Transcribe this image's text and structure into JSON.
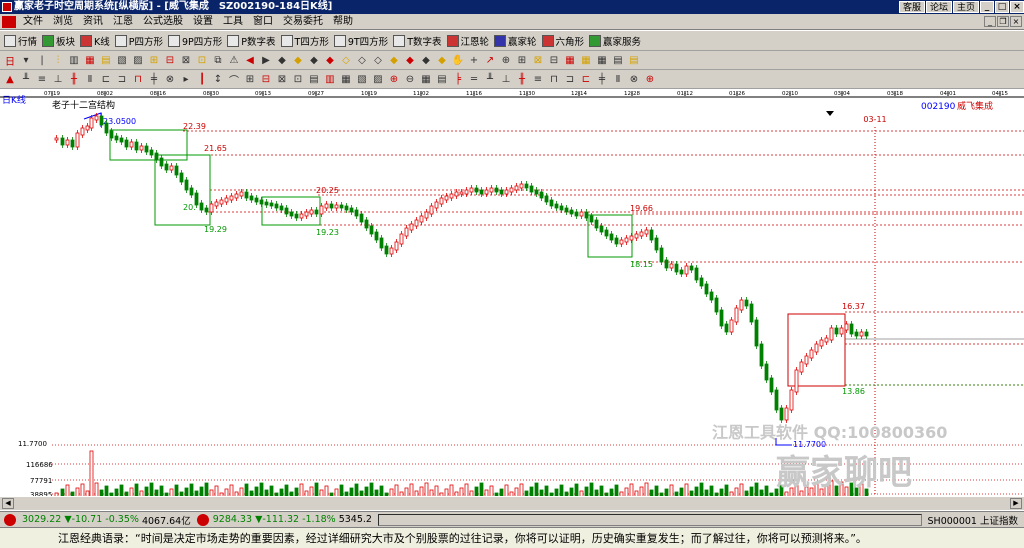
{
  "window": {
    "title": "赢家老子时空周期系统[纵横版] - [威飞集成　SZ002190-184日K线]",
    "links": [
      "客服",
      "论坛",
      "主页"
    ]
  },
  "menu": [
    "文件",
    "浏览",
    "资讯",
    "江恩",
    "公式选股",
    "设置",
    "工具",
    "窗口",
    "交易委托",
    "帮助"
  ],
  "toolbar1": [
    {
      "label": "行情",
      "icon": "grid-icon"
    },
    {
      "label": "板块",
      "icon": "blocks-icon"
    },
    {
      "label": "K线",
      "icon": "kline-icon"
    },
    {
      "label": "P四方形",
      "icon": "square-icon"
    },
    {
      "label": "9P四方形",
      "icon": "square-icon"
    },
    {
      "label": "P数字表",
      "icon": "table-icon"
    },
    {
      "label": "T四方形",
      "icon": "square-icon"
    },
    {
      "label": "9T四方形",
      "icon": "square-icon"
    },
    {
      "label": "T数字表",
      "icon": "table-icon"
    },
    {
      "label": "江恩轮",
      "icon": "wheel-icon"
    },
    {
      "label": "赢家轮",
      "icon": "wheel-icon"
    },
    {
      "label": "六角形",
      "icon": "hexagon-icon"
    },
    {
      "label": "赢家服务",
      "icon": "service-icon"
    }
  ],
  "chart": {
    "period_label": "日K线",
    "indicator_title": "老子十二宫结构",
    "stock_code": "002190",
    "stock_name": "威飞集成",
    "date_ticks": [
      "07-19",
      "08-02",
      "08-16",
      "08-30",
      "09-13",
      "09-27",
      "10-19",
      "11-02",
      "11-16",
      "11-30",
      "12-14",
      "12-28",
      "01-12",
      "01-26",
      "02-10",
      "03-04",
      "03-18",
      "04-01",
      "04-15"
    ],
    "marker_date": "03-11",
    "y_axis_label": "11.7700",
    "volume_ticks": [
      "116686",
      "77791",
      "38895"
    ],
    "annotations": [
      "23.0500",
      "22.39",
      "21.65",
      "20.",
      "19.29",
      "20.25",
      "19.23",
      "19.66",
      "18.15",
      "16.37",
      "13.86",
      "11.7700"
    ],
    "colors": {
      "up": "#e00000",
      "down": "#008000",
      "grid": "#e00000",
      "box_green": "#009900",
      "box_red": "#cc0000",
      "link": "#0000ff"
    }
  },
  "watermark": {
    "line1": "江恩工具软件  QQ:100800360",
    "line2": "赢家聊吧"
  },
  "status": {
    "sh_index": "3029.22",
    "sh_change": "▼-10.71",
    "sh_pct": "-0.35%",
    "sh_amount": "4067.64亿",
    "sz_index": "9284.33",
    "sz_change": "▼-111.32",
    "sz_pct": "-1.18%",
    "sz_amount": "5345.2",
    "ticker": "SH000001 上证指数"
  },
  "quote": "江恩经典语录：“时间是决定市场走势的重要因素，经过详细研究大市及个别股票的过往记录，你将可以证明，历史确实重复发生；而了解过往，你将可以预测将来。”。"
}
